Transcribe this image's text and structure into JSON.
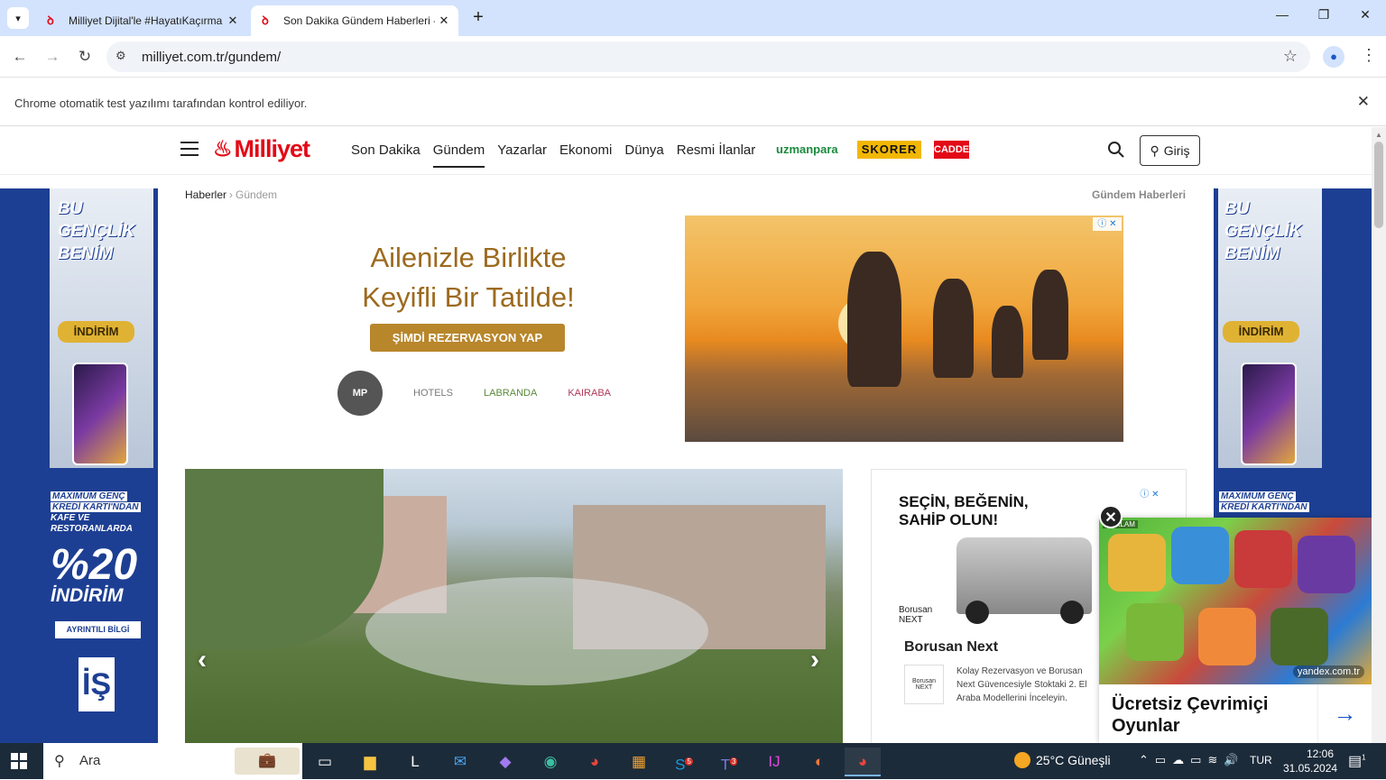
{
  "browser": {
    "tabs": [
      {
        "title": "Milliyet Dijital'le #HayatıKaçırma",
        "active": false
      },
      {
        "title": "Son Dakika Gündem Haberleri -",
        "active": true
      }
    ],
    "url": "milliyet.com.tr/gundem/",
    "infobar": "Chrome otomatik test yazılımı tarafından kontrol ediliyor."
  },
  "site": {
    "logo": "Milliyet",
    "nav": [
      "Son Dakika",
      "Gündem",
      "Yazarlar",
      "Ekonomi",
      "Dünya",
      "Resmi İlanlar"
    ],
    "active_nav": "Gündem",
    "brands": {
      "uzmanpara": "uzmanpara",
      "skorer": "SKORER",
      "cadde": "CADDE"
    },
    "login": "Giriş",
    "breadcrumb": {
      "home": "Haberler",
      "current": "Gündem"
    },
    "section_title": "Gündem Haberleri"
  },
  "skin_ad": {
    "headline": "BU GENÇLİK BENİM",
    "badge": "İNDİRİM",
    "promo_line1": "MAXIMUM GENÇ",
    "promo_line2": "KREDİ KARTI'NDAN",
    "promo_line3": "KAFE VE RESTORANLARDA",
    "big": "%20",
    "discount": "İNDİRİM",
    "button": "AYRINTILI BİLGİ",
    "bank_logo": "İŞ"
  },
  "hotel_ad": {
    "line1": "Ailenizle Birlikte",
    "line2": "Keyifli Bir Tatilde!",
    "cta": "ŞİMDİ REZERVASYON YAP",
    "logos": [
      "MP",
      "HOTELS",
      "LABRANDA",
      "KAIRABA"
    ]
  },
  "car_ad": {
    "headline1": "SEÇİN, BEĞENİN,",
    "headline2": "SAHİP OLUN!",
    "brand_small": "Borusan NEXT",
    "name": "Borusan Next",
    "description": "Kolay Rezervasyon ve Borusan Next Güvencesiyle Stoktaki 2. El Araba Modellerini İnceleyin."
  },
  "yandex_ad": {
    "label": "REKLAM",
    "domain": "yandex.com.tr",
    "title": "Ücretsiz Çevrimiçi Oyunlar"
  },
  "taskbar": {
    "search_placeholder": "Ara",
    "weather": "25°C Güneşli",
    "lang": "TUR",
    "time": "12:06",
    "date": "31.05.2024",
    "notification_count": "1",
    "badge_skype": "5",
    "badge_teams": "3"
  }
}
